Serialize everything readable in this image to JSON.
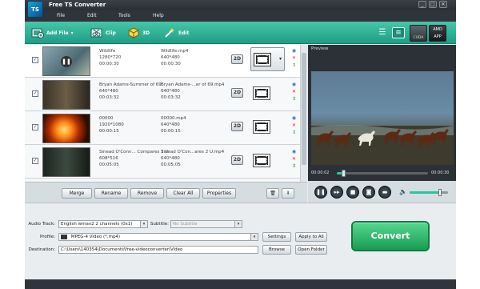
{
  "app": {
    "title": "Free TS Converter",
    "logo": "TS"
  },
  "window_buttons": [
    "_",
    "□",
    "✕"
  ],
  "menu": [
    {
      "label": "File"
    },
    {
      "label": "Edit"
    },
    {
      "label": "Tools"
    },
    {
      "label": "Help"
    }
  ],
  "toolbar": {
    "add_file": "Add File",
    "clip": "Clip",
    "three_d": "3D",
    "edit": "Edit",
    "amd_line1": "AMD",
    "amd_line2": "APP",
    "cuda_label": "CUDA"
  },
  "files": [
    {
      "name": "Wildlife",
      "res": "1280*720",
      "dur": "00:00:30",
      "out_name": "Wildlife.mp4",
      "out_res": "640*480",
      "out_dur": "00:00:30",
      "mode": "2D",
      "checked": true
    },
    {
      "name": "Bryan Adams-Summer of 69",
      "res": "640*480",
      "dur": "00:03:32",
      "out_name": "Bryan Adams-...er of 69.mp4",
      "out_res": "640*480",
      "out_dur": "00:03:32",
      "mode": "2D",
      "checked": true
    },
    {
      "name": "00000",
      "res": "1920*1080",
      "dur": "00:00:15",
      "out_name": "00000.mp4",
      "out_res": "640*480",
      "out_dur": "00:00:15",
      "mode": "2D",
      "checked": true
    },
    {
      "name": "Sinead O'Conn... Compares 2 U",
      "res": "608*516",
      "dur": "00:05:05",
      "out_name": "Sinead O'Con...ares 2 U.mp4",
      "out_res": "640*480",
      "out_dur": "00:05:05",
      "mode": "2D",
      "checked": true
    }
  ],
  "actions": {
    "merge": "Merge",
    "rename": "Rename",
    "remove": "Remove",
    "clear_all": "Clear All",
    "properties": "Properties"
  },
  "preview": {
    "label": "Preview",
    "time_current": "00:00:02",
    "time_total": "00:00:30",
    "progress": 0.07,
    "volume": 0.8
  },
  "settings": {
    "audio_track_label": "Audio Track:",
    "audio_track_value": "English wmav2 2 channels (0x1)",
    "subtitle_label": "Subtitle:",
    "subtitle_value": "No Subtitle",
    "profile_label": "Profile:",
    "profile_value": "MPEG-4 Video (*.mp4)",
    "settings_btn": "Settings",
    "apply_all_btn": "Apply to All",
    "destination_label": "Destination:",
    "destination_value": "C:\\Users\\140354\\Documents\\free-videoconverter\\Video",
    "browse_btn": "Browse",
    "open_folder_btn": "Open Folder",
    "convert_btn": "Convert"
  }
}
